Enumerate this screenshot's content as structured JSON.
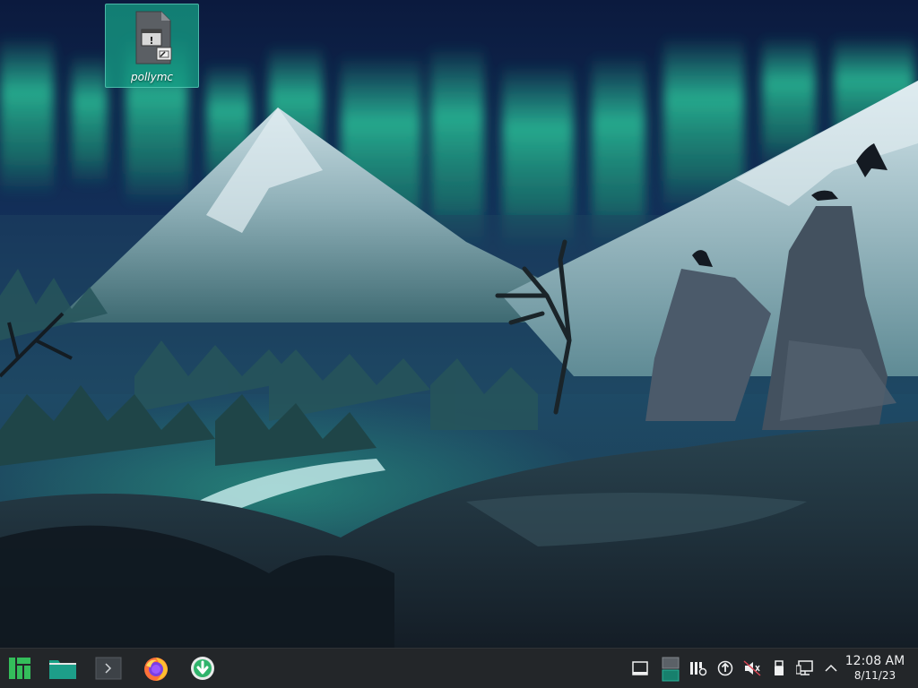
{
  "desktop": {
    "icons": [
      {
        "label": "pollymc"
      }
    ]
  },
  "taskbar": {
    "launchers": [
      {
        "icon": "manjaro-menu-icon"
      },
      {
        "icon": "file-manager-icon"
      },
      {
        "icon": "terminal-icon"
      },
      {
        "icon": "firefox-icon"
      },
      {
        "icon": "software-update-icon"
      }
    ],
    "tray": [
      {
        "icon": "show-desktop-icon"
      },
      {
        "icon": "pager-icon"
      },
      {
        "icon": "clipboard-settings-icon"
      },
      {
        "icon": "updates-icon"
      },
      {
        "icon": "volume-muted-icon"
      },
      {
        "icon": "usb-device-icon"
      },
      {
        "icon": "network-icon"
      },
      {
        "icon": "expand-tray-icon"
      }
    ],
    "clock": {
      "time": "12:08 AM",
      "date": "8/11/23"
    }
  },
  "colors": {
    "taskbar_bg": "#232629",
    "accent": "#16a085",
    "aurora": "#2fe0a8"
  }
}
